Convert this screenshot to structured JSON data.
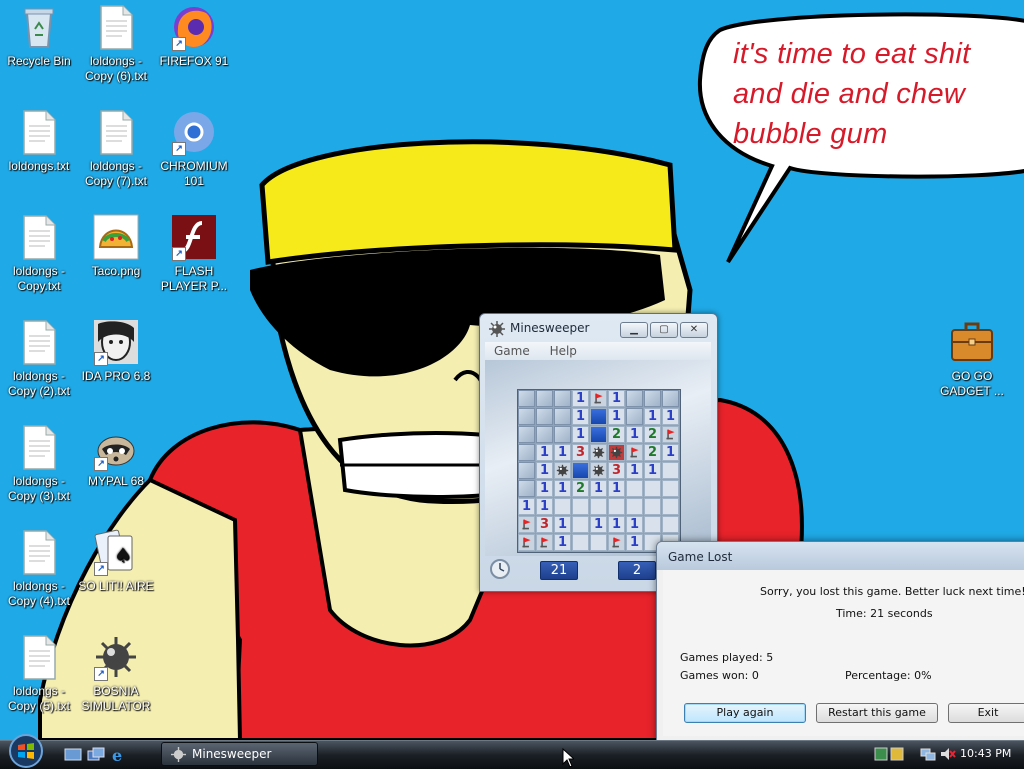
{
  "desktop": {
    "speech_bubble": [
      "it's time to eat shit",
      "and die and chew",
      "bubble gum"
    ],
    "icons": [
      {
        "label": "Recycle Bin",
        "icon": "recycle-bin-icon"
      },
      {
        "label": "loldongs - Copy (6).txt",
        "icon": "text-file-icon"
      },
      {
        "label": "FIREFOX 91",
        "icon": "firefox-icon"
      },
      {
        "label": "loldongs.txt",
        "icon": "text-file-icon"
      },
      {
        "label": "loldongs - Copy (7).txt",
        "icon": "text-file-icon"
      },
      {
        "label": "CHROMIUM 101",
        "icon": "chromium-icon"
      },
      {
        "label": "loldongs - Copy.txt",
        "icon": "text-file-icon"
      },
      {
        "label": "Taco.png",
        "icon": "taco-image-icon"
      },
      {
        "label": "FLASH PLAYER P...",
        "icon": "flash-player-icon"
      },
      {
        "label": "loldongs - Copy (2).txt",
        "icon": "text-file-icon"
      },
      {
        "label": "IDA PRO 6.8",
        "icon": "ida-pro-icon"
      },
      {
        "label": "loldongs - Copy (3).txt",
        "icon": "text-file-icon"
      },
      {
        "label": "MYPAL 68",
        "icon": "raccoon-icon"
      },
      {
        "label": "loldongs - Copy (4).txt",
        "icon": "text-file-icon"
      },
      {
        "label": "SO LIT!! AIRE",
        "icon": "solitaire-icon"
      },
      {
        "label": "loldongs - Copy (5).txt",
        "icon": "text-file-icon"
      },
      {
        "label": "BOSNIA SIMULATOR",
        "icon": "mine-icon"
      },
      {
        "label": "GO GO GADGET ...",
        "icon": "briefcase-icon"
      }
    ]
  },
  "minesweeper": {
    "title": "Minesweeper",
    "menu": [
      "Game",
      "Help"
    ],
    "board": [
      [
        "u",
        "u",
        "u",
        "1",
        "x",
        "1",
        "u",
        "u",
        "u"
      ],
      [
        "u",
        "u",
        "u",
        "1",
        "b",
        "1",
        "u",
        "1",
        "1"
      ],
      [
        "u",
        "u",
        "u",
        "1",
        "b",
        "2",
        "1",
        "2",
        "f"
      ],
      [
        "u",
        "1",
        "1",
        "3",
        "m",
        "M",
        "f",
        "2",
        "1"
      ],
      [
        "u",
        "1",
        "m",
        "b",
        "m",
        "3",
        "1",
        "1",
        "r"
      ],
      [
        "u",
        "1",
        "1",
        "2",
        "1",
        "1",
        "r",
        "r",
        "r"
      ],
      [
        "1",
        "1",
        "r",
        "r",
        "r",
        "r",
        "r",
        "r",
        "r"
      ],
      [
        "f",
        "3",
        "1",
        "r",
        "1",
        "1",
        "1",
        "r",
        "r"
      ],
      [
        "f",
        "f",
        "1",
        "r",
        "r",
        "f",
        "1",
        "r",
        "r"
      ]
    ],
    "timer": "21",
    "mines_left": "2"
  },
  "dialog": {
    "title": "Game Lost",
    "message": "Sorry, you lost this game. Better luck next time!",
    "time": "Time: 21 seconds",
    "games_played": "Games played: 5",
    "games_won": "Games won: 0",
    "percentage": "Percentage: 0%",
    "buttons": {
      "play_again": "Play again",
      "restart": "Restart this game",
      "exit": "Exit"
    }
  },
  "taskbar": {
    "task_label": "Minesweeper",
    "clock": "10:43 PM"
  },
  "colors": {
    "sky": "#1fa9e6",
    "speech_text": "#d61a2a",
    "num1": "#2b3fc8",
    "num2": "#1e7a2a",
    "num3": "#c0262b"
  }
}
